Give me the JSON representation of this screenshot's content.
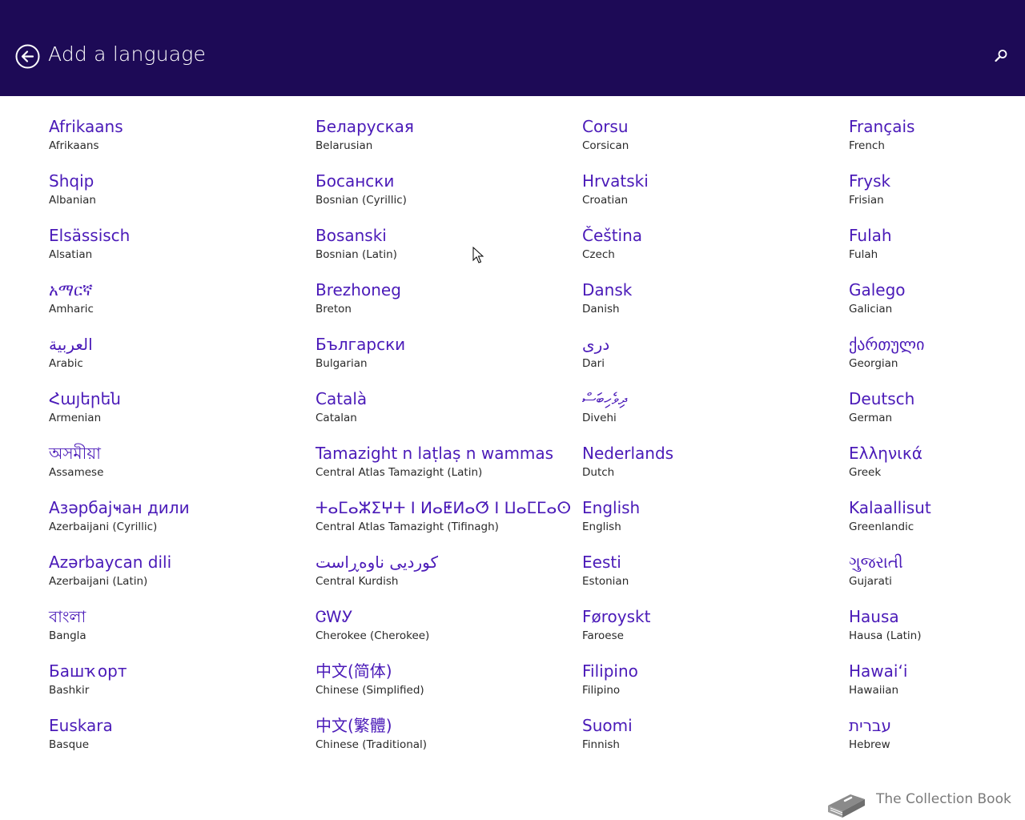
{
  "header": {
    "title": "Add a language",
    "back_icon": "back-arrow-icon",
    "search_icon": "search-icon",
    "background": "#1d0a56"
  },
  "accent_color": "#4a1ab8",
  "columns": [
    [
      {
        "native": "Afrikaans",
        "english": "Afrikaans"
      },
      {
        "native": "Shqip",
        "english": "Albanian"
      },
      {
        "native": "Elsässisch",
        "english": "Alsatian"
      },
      {
        "native": "አማርኛ",
        "english": "Amharic"
      },
      {
        "native": "العربية",
        "english": "Arabic"
      },
      {
        "native": "Հայերեն",
        "english": "Armenian"
      },
      {
        "native": "অসমীয়া",
        "english": "Assamese"
      },
      {
        "native": "Азәрбајҹан дили",
        "english": "Azerbaijani (Cyrillic)"
      },
      {
        "native": "Azərbaycan dili",
        "english": "Azerbaijani (Latin)"
      },
      {
        "native": "বাংলা",
        "english": "Bangla"
      },
      {
        "native": "Башҡорт",
        "english": "Bashkir"
      },
      {
        "native": "Euskara",
        "english": "Basque"
      }
    ],
    [
      {
        "native": "Беларуская",
        "english": "Belarusian"
      },
      {
        "native": "Босански",
        "english": "Bosnian (Cyrillic)"
      },
      {
        "native": "Bosanski",
        "english": "Bosnian (Latin)"
      },
      {
        "native": "Brezhoneg",
        "english": "Breton"
      },
      {
        "native": "Български",
        "english": "Bulgarian"
      },
      {
        "native": "Català",
        "english": "Catalan"
      },
      {
        "native": "Tamazight n laṭlaṣ n wammas",
        "english": "Central Atlas Tamazight (Latin)"
      },
      {
        "native": "ⵜⴰⵎⴰⵣⵉⵖⵜ ⵏ ⵍⴰⵟⵍⴰⵚ ⵏ ⵡⴰⵎⵎⴰⵙ",
        "english": "Central Atlas Tamazight (Tifinagh)"
      },
      {
        "native": "کوردیی ناوەڕاست",
        "english": "Central Kurdish"
      },
      {
        "native": "ᏣᎳᎩ",
        "english": "Cherokee (Cherokee)"
      },
      {
        "native": "中文(简体)",
        "english": "Chinese (Simplified)"
      },
      {
        "native": "中文(繁體)",
        "english": "Chinese (Traditional)"
      }
    ],
    [
      {
        "native": "Corsu",
        "english": "Corsican"
      },
      {
        "native": "Hrvatski",
        "english": "Croatian"
      },
      {
        "native": "Čeština",
        "english": "Czech"
      },
      {
        "native": "Dansk",
        "english": "Danish"
      },
      {
        "native": "درى",
        "english": "Dari"
      },
      {
        "native": "ދިވެހިބަސް",
        "english": "Divehi"
      },
      {
        "native": "Nederlands",
        "english": "Dutch"
      },
      {
        "native": "English",
        "english": "English"
      },
      {
        "native": "Eesti",
        "english": "Estonian"
      },
      {
        "native": "Føroyskt",
        "english": "Faroese"
      },
      {
        "native": "Filipino",
        "english": "Filipino"
      },
      {
        "native": "Suomi",
        "english": "Finnish"
      }
    ],
    [
      {
        "native": "Français",
        "english": "French"
      },
      {
        "native": "Frysk",
        "english": "Frisian"
      },
      {
        "native": "Fulah",
        "english": "Fulah"
      },
      {
        "native": "Galego",
        "english": "Galician"
      },
      {
        "native": "ქართული",
        "english": "Georgian"
      },
      {
        "native": "Deutsch",
        "english": "German"
      },
      {
        "native": "Ελληνικά",
        "english": "Greek"
      },
      {
        "native": "Kalaallisut",
        "english": "Greenlandic"
      },
      {
        "native": "ગુજરાતી",
        "english": "Gujarati"
      },
      {
        "native": "Hausa",
        "english": "Hausa (Latin)"
      },
      {
        "native": "Hawaiʻi",
        "english": "Hawaiian"
      },
      {
        "native": "עברית",
        "english": "Hebrew"
      }
    ]
  ],
  "watermark": {
    "text": "The Collection Book",
    "icon": "book-icon"
  }
}
